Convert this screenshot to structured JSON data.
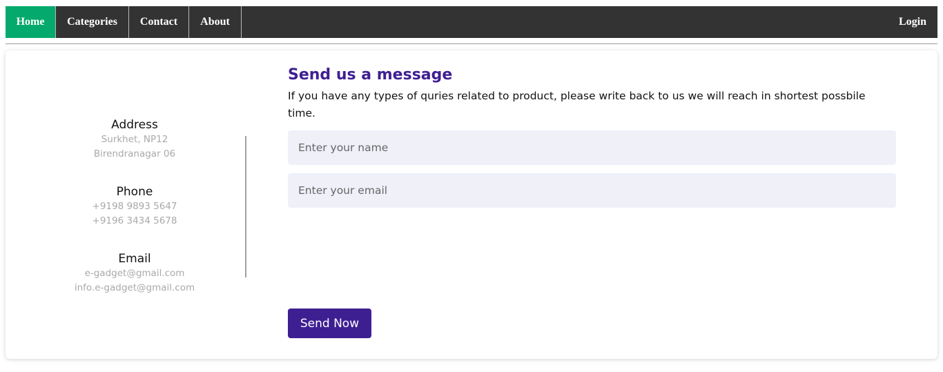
{
  "nav": {
    "home": "Home",
    "categories": "Categories",
    "contact": "Contact",
    "about": "About",
    "login": "Login",
    "active_color": "#04aa6d",
    "bar_color": "#333333"
  },
  "contact_info": {
    "address": {
      "title": "Address",
      "lines": [
        "Surkhet, NP12",
        "Birendranagar 06"
      ]
    },
    "phone": {
      "title": "Phone",
      "lines": [
        "+9198 9893 5647",
        "+9196 3434 5678"
      ]
    },
    "email": {
      "title": "Email",
      "lines": [
        "e-gadget@gmail.com",
        "info.e-gadget@gmail.com"
      ]
    }
  },
  "form": {
    "heading": "Send us a message",
    "description": "If you have any types of quries related to product, please write back to us we will reach in shortest possbile time.",
    "name_placeholder": "Enter your name",
    "email_placeholder": "Enter your email",
    "submit_label": "Send Now",
    "accent_color": "#3e1f92"
  }
}
